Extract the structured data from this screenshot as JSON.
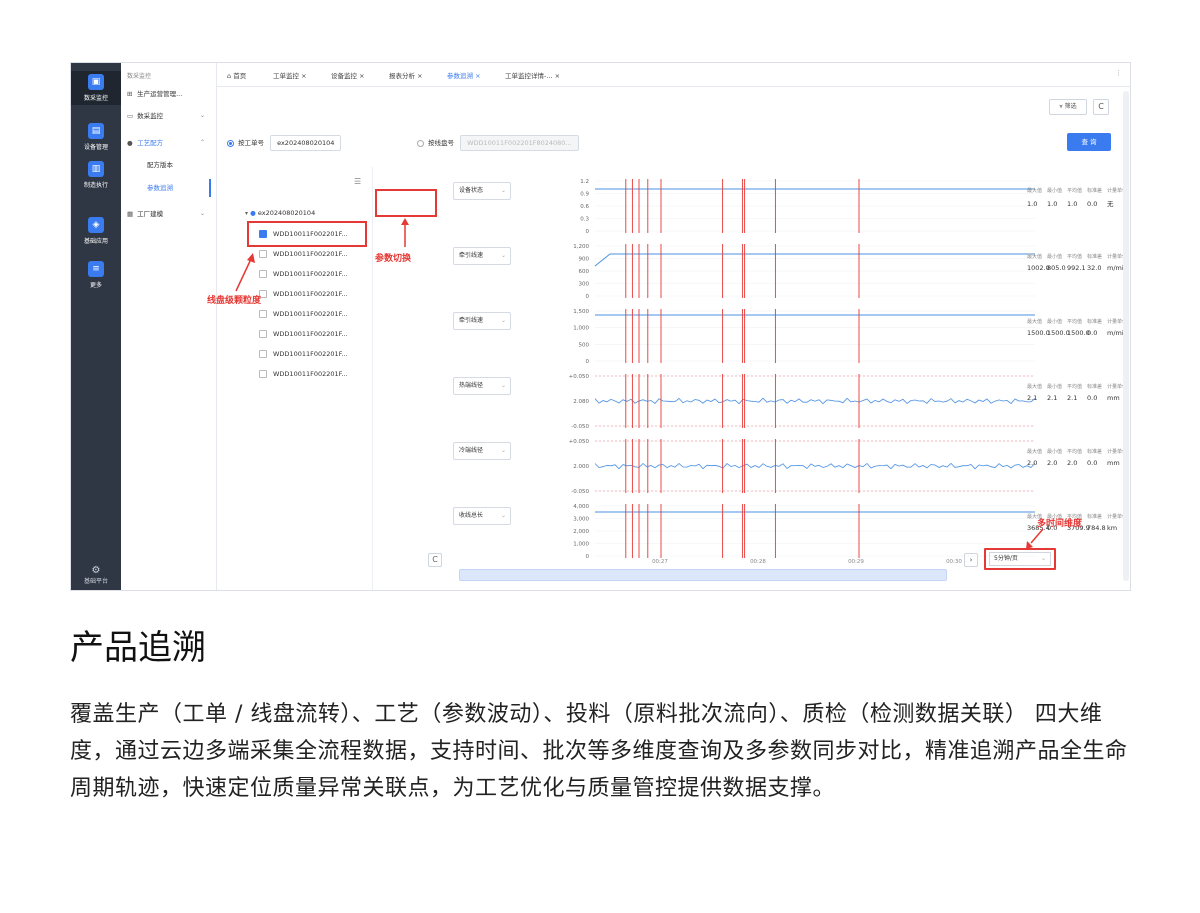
{
  "rail": {
    "items": [
      {
        "label": "数采监控",
        "icon": "monitor-icon"
      },
      {
        "label": "设备管理",
        "icon": "device-icon"
      },
      {
        "label": "制造执行",
        "icon": "execution-icon"
      },
      {
        "label": "基础应用",
        "icon": "apps-icon"
      },
      {
        "label": "更多",
        "icon": "more-icon"
      }
    ],
    "bottom_label": "基础平台"
  },
  "nav": {
    "header": "数采监控",
    "items": [
      "生产运营管理...",
      "数采监控",
      "工艺配方",
      "配方版本",
      "参数追溯",
      "工厂建模"
    ]
  },
  "tabs": [
    "首页",
    "工单监控",
    "设备监控",
    "报表分析",
    "参数追溯",
    "工单监控详情-..."
  ],
  "toolbar": {
    "filter_label": "筛选",
    "refresh_icon": "C",
    "query_label": "查 询"
  },
  "search": {
    "work_order_label": "按工单号",
    "work_order_value": "ex202408020104",
    "coil_label": "按线盘号",
    "coil_placeholder": "WDD10011F002201F8024080..."
  },
  "tree": {
    "root": "ex202408020104",
    "children": [
      "WDD10011F002201F...",
      "WDD10011F002201F...",
      "WDD10011F002201F...",
      "WDD10011F002201F...",
      "WDD10011F002201F...",
      "WDD10011F002201F...",
      "WDD10011F002201F...",
      "WDD10011F002201F..."
    ]
  },
  "params": [
    {
      "name": "设备状态",
      "yticks": [
        "1.2",
        "0.9",
        "0.6",
        "0.3",
        "0"
      ],
      "stats": [
        "1.0",
        "1.0",
        "1.0",
        "0.0",
        "无"
      ]
    },
    {
      "name": "牵引线速",
      "yticks": [
        "1,200",
        "900",
        "600",
        "300",
        "0"
      ],
      "stats": [
        "1002.0",
        "805.0",
        "992.1",
        "32.0",
        "m/min"
      ]
    },
    {
      "name": "牵引线速",
      "yticks": [
        "1,500",
        "1,000",
        "500",
        "0"
      ],
      "stats": [
        "1500.0",
        "1500.0",
        "1500.0",
        "0.0",
        "m/min"
      ]
    },
    {
      "name": "热端线径",
      "yticks": [
        "+0.050",
        "2.080",
        "-0.050"
      ],
      "stats": [
        "2.1",
        "2.1",
        "2.1",
        "0.0",
        "mm"
      ]
    },
    {
      "name": "冷端线径",
      "yticks": [
        "+0.050",
        "2.000",
        "-0.050"
      ],
      "stats": [
        "2.0",
        "2.0",
        "2.0",
        "0.0",
        "mm"
      ]
    },
    {
      "name": "收线总长",
      "yticks": [
        "4,000",
        "3,000",
        "2,000",
        "1,000",
        "0"
      ],
      "stats": [
        "3685.4",
        "0.0",
        "3709.9",
        "784.8",
        "km"
      ]
    }
  ],
  "stat_headers": [
    "最大值",
    "最小值",
    "平均值",
    "标准差",
    "计量单位"
  ],
  "xticks": [
    "00:27",
    "00:28",
    "00:29",
    "00:30",
    "00:31"
  ],
  "granularity": "5分钟/页",
  "annotations": {
    "param_switch": "参数切换",
    "coil_granularity": "线盘级颗粒度",
    "multi_time": "多时间维度"
  },
  "colors": {
    "accent": "#3a7cf0",
    "alert": "#e53935"
  },
  "section": {
    "title": "产品追溯",
    "description": "覆盖生产（工单 / 线盘流转）、工艺（参数波动）、投料（原料批次流向）、质检（检测数据关联） 四大维度，通过云边多端采集全流程数据，支持时间、批次等多维度查询及多参数同步对比，精准追溯产品全生命周期轨迹，快速定位质量异常关联点，为工艺优化与质量管控提供数据支撑。"
  }
}
